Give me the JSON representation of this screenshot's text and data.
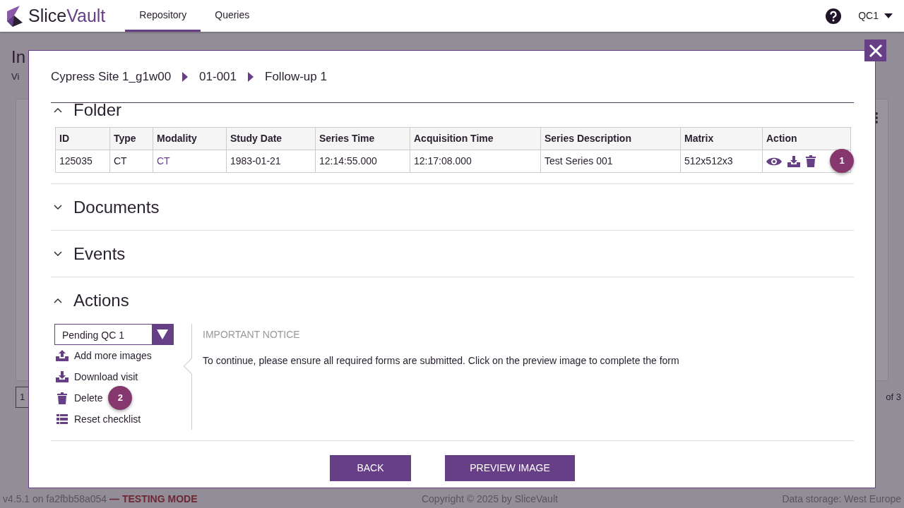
{
  "brand": {
    "first": "Slice",
    "second": "Vault"
  },
  "nav_tabs": [
    {
      "label": "Repository",
      "selected": true
    },
    {
      "label": "Queries",
      "selected": false
    }
  ],
  "user_menu": {
    "label": "QC1"
  },
  "background": {
    "title": "In",
    "subtitle": "Vi",
    "pagination_current": "1",
    "page_count": "of 3"
  },
  "footer": {
    "version": "v4.5.1 on fa2fbb58a054",
    "mode": "— TESTING MODE",
    "copyright": "Copyright © 2025 by SliceVault",
    "storage": "Data storage: West Europe"
  },
  "modal": {
    "breadcrumb": [
      "Cypress Site 1_g1w00",
      "01-001",
      "Follow-up 1"
    ],
    "sections": [
      {
        "title": "Folder",
        "expanded": true,
        "kind": "table"
      },
      {
        "title": "Documents",
        "expanded": false
      },
      {
        "title": "Events",
        "expanded": false
      },
      {
        "title": "Actions",
        "expanded": true,
        "kind": "actions"
      }
    ],
    "table": {
      "columns": [
        {
          "label": "ID",
          "kind": "text"
        },
        {
          "label": "Type",
          "kind": "text"
        },
        {
          "label": "Modality",
          "kind": "link"
        },
        {
          "label": "Study Date",
          "kind": "text"
        },
        {
          "label": "Series Time",
          "kind": "text"
        },
        {
          "label": "Acquisition Time",
          "kind": "text"
        },
        {
          "label": "Series Description",
          "kind": "text"
        },
        {
          "label": "Matrix",
          "kind": "text"
        },
        {
          "label": "Action",
          "kind": "actions"
        }
      ],
      "rows": [
        {
          "cells": [
            "125035",
            "CT",
            "CT",
            "1983-01-21",
            "12:14:55.000",
            "12:17:08.000",
            "Test Series 001",
            "512x512x3"
          ],
          "marker": "1"
        }
      ]
    },
    "status_select": {
      "value": "Pending QC 1"
    },
    "action_links": [
      {
        "label": "Add more images",
        "kind": "upload"
      },
      {
        "label": "Download visit",
        "kind": "download"
      },
      {
        "label": "Delete",
        "kind": "delete",
        "marker": "2"
      },
      {
        "label": "Reset checklist",
        "kind": "reset"
      }
    ],
    "notice": {
      "heading": "IMPORTANT NOTICE",
      "text": "To continue, please ensure all required forms are submitted. Click on the preview image to complete the form"
    },
    "buttons": [
      "BACK",
      "PREVIEW IMAGE"
    ]
  }
}
